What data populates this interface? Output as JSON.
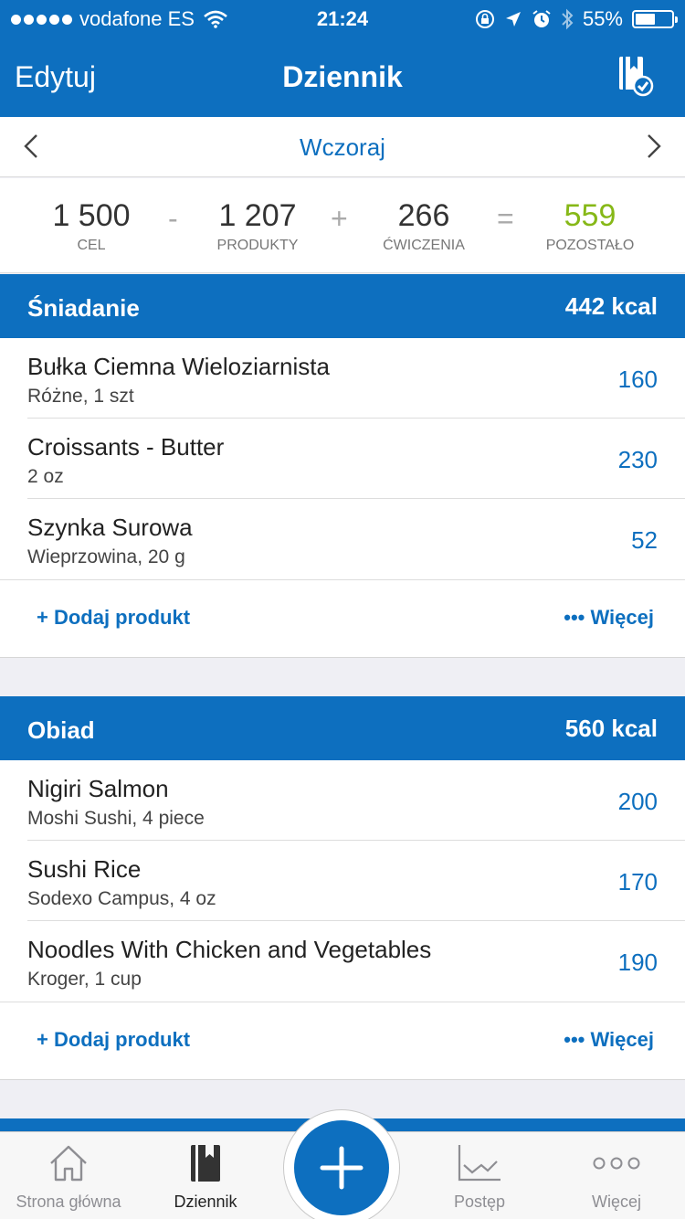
{
  "status": {
    "carrier": "vodafone ES",
    "time": "21:24",
    "battery": "55%",
    "battery_level": 0.55
  },
  "nav": {
    "edit": "Edytuj",
    "title": "Dziennik"
  },
  "date": {
    "label": "Wczoraj"
  },
  "summary": {
    "goal": {
      "value": "1 500",
      "label": "CEL"
    },
    "food": {
      "value": "1 207",
      "label": "PRODUKTY"
    },
    "exercise": {
      "value": "266",
      "label": "ĆWICZENIA"
    },
    "remaining": {
      "value": "559",
      "label": "POZOSTAŁO"
    },
    "ops": [
      "-",
      "+",
      "="
    ]
  },
  "meals": [
    {
      "name": "Śniadanie",
      "kcal": "442 kcal",
      "items": [
        {
          "name": "Bułka Ciemna Wieloziarnista",
          "desc": "Różne, 1 szt",
          "cal": "160"
        },
        {
          "name": "Croissants - Butter",
          "desc": "2 oz",
          "cal": "230"
        },
        {
          "name": "Szynka Surowa",
          "desc": "Wieprzowina, 20 g",
          "cal": "52"
        }
      ],
      "add": "+ Dodaj produkt",
      "more": "••• Więcej"
    },
    {
      "name": "Obiad",
      "kcal": "560 kcal",
      "items": [
        {
          "name": "Nigiri Salmon",
          "desc": "Moshi Sushi, 4 piece",
          "cal": "200"
        },
        {
          "name": "Sushi Rice",
          "desc": "Sodexo Campus, 4 oz",
          "cal": "170"
        },
        {
          "name": "Noodles With Chicken and Vegetables",
          "desc": "Kroger, 1 cup",
          "cal": "190"
        }
      ],
      "add": "+ Dodaj produkt",
      "more": "••• Więcej"
    }
  ],
  "tabs": {
    "home": "Strona główna",
    "diary": "Dziennik",
    "progress": "Postęp",
    "more": "Więcej"
  },
  "colors": {
    "primary": "#0d6fbf",
    "remaining": "#86b817",
    "tab_inactive": "#8e8e93"
  }
}
